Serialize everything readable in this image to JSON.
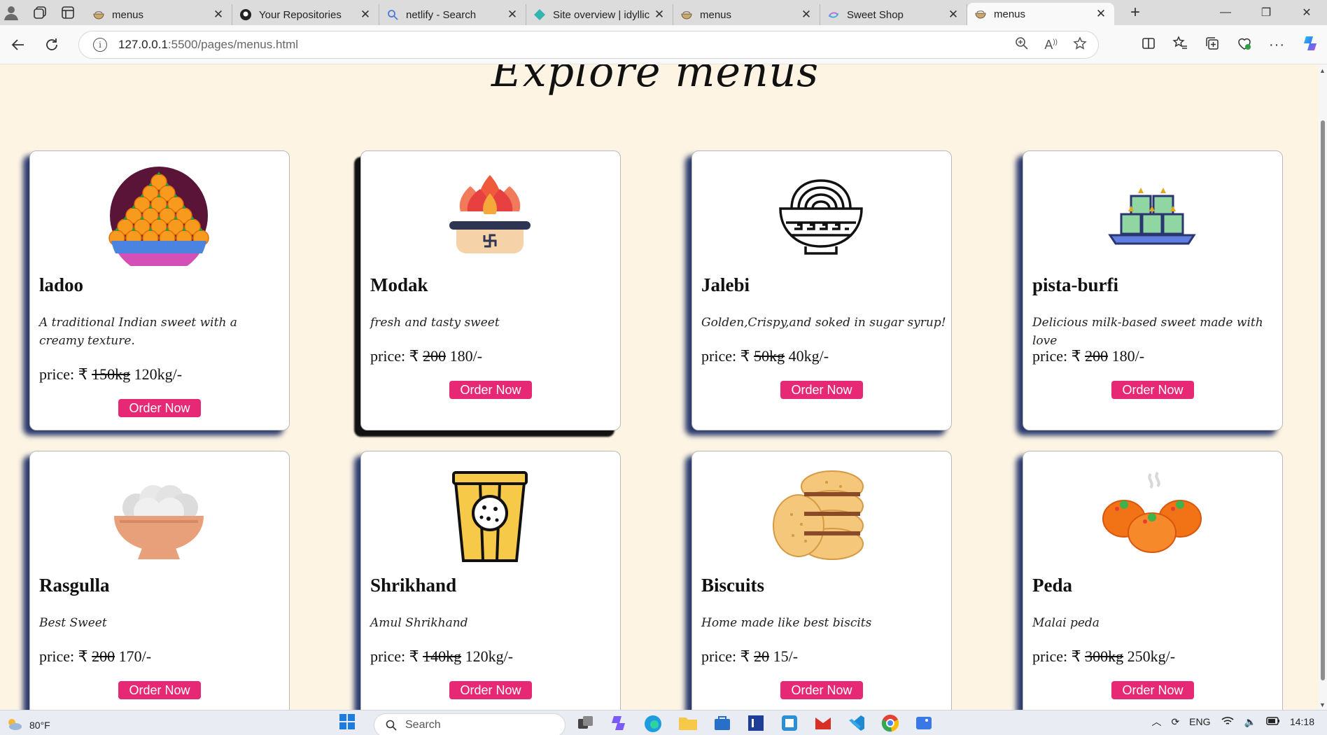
{
  "browser": {
    "tabs": [
      {
        "title": "menus",
        "favicon": "bowl-icon",
        "active": false
      },
      {
        "title": "Your Repositories",
        "favicon": "github-icon",
        "active": false
      },
      {
        "title": "netlify - Search",
        "favicon": "search-icon",
        "active": false
      },
      {
        "title": "Site overview | idyllic",
        "favicon": "netlify-icon",
        "active": false
      },
      {
        "title": "menus",
        "favicon": "bowl-icon",
        "active": false
      },
      {
        "title": "Sweet Shop",
        "favicon": "swirl-icon",
        "active": false
      },
      {
        "title": "menus",
        "favicon": "bowl-icon",
        "active": true
      }
    ],
    "url_host": "127.0.0.1",
    "url_rest": ":5500/pages/menus.html"
  },
  "page": {
    "title": "Explore menus",
    "price_label": "price: ₹",
    "order_label": "Order Now",
    "items": [
      {
        "name": "ladoo",
        "desc": "A traditional Indian sweet with a creamy texture.",
        "old": "150kg",
        "new": "120kg/-",
        "icon": "ladoo-icon"
      },
      {
        "name": "Modak",
        "desc": "fresh and tasty sweet",
        "old": "200",
        "new": "180/-",
        "icon": "modak-icon"
      },
      {
        "name": "Jalebi",
        "desc": "Golden,Crispy,and soked in sugar syrup!",
        "old": "50kg",
        "new": "40kg/-",
        "icon": "jalebi-bowl-icon"
      },
      {
        "name": "pista-burfi",
        "desc": "Delicious milk-based sweet made with love",
        "old": "200",
        "new": "180/-",
        "icon": "burfi-icon"
      },
      {
        "name": "Rasgulla",
        "desc": "Best Sweet",
        "old": "200",
        "new": "170/-",
        "icon": "rasgulla-icon"
      },
      {
        "name": "Shrikhand",
        "desc": "Amul Shrikhand",
        "old": "140kg",
        "new": "120kg/-",
        "icon": "shrikhand-cup-icon"
      },
      {
        "name": "Biscuits",
        "desc": "Home made like best biscits",
        "old": "20",
        "new": "15/-",
        "icon": "biscuits-icon"
      },
      {
        "name": "Peda",
        "desc": "Malai peda",
        "old": "300kg",
        "new": "250kg/-",
        "icon": "peda-icon"
      }
    ]
  },
  "taskbar": {
    "temperature": "80°F",
    "search_placeholder": "Search",
    "language": "ENG",
    "time": "14:18"
  },
  "colors": {
    "page_bg": "#fdf4e3",
    "button": "#e72874",
    "card_shadow": "#2b3a6e"
  }
}
